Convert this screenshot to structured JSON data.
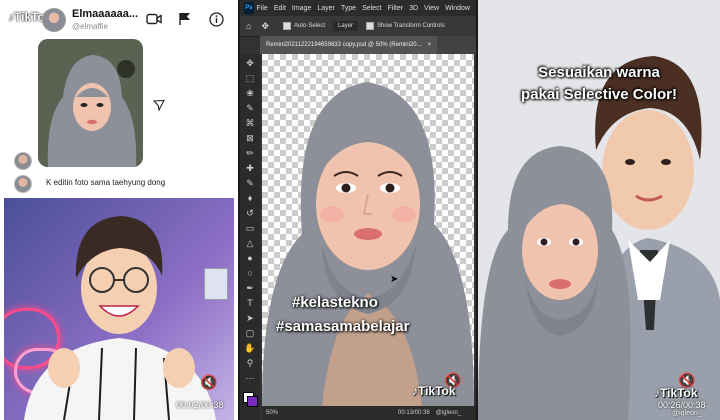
{
  "panel1": {
    "logo": "TikTok",
    "username": "Elmaaaaaa...",
    "handle": "@elmaffie",
    "chat_message": "K editin foto sama taehyung dong",
    "time": "00:02/00:38",
    "icons": [
      "tiktok-logo-icon",
      "video-camera-icon",
      "flag-icon",
      "info-icon",
      "share-icon",
      "mute-icon"
    ]
  },
  "panel2": {
    "menu": [
      "File",
      "Edit",
      "Image",
      "Layer",
      "Type",
      "Select",
      "Filter",
      "3D",
      "View",
      "Window"
    ],
    "options": {
      "auto_select": "Auto-Select",
      "layer_select": "Layer",
      "transform": "Show Transform Controls"
    },
    "doc_tab": "Remini20211222194659833 copy.psd @ 50% (Remini20...",
    "close_tab": "×",
    "hashtags": [
      "#kelastekno",
      "#samasamabelajar"
    ],
    "status": "50%",
    "tiktok": "TikTok",
    "handle": "@igleon_",
    "time": "00:13/00:38"
  },
  "panel3": {
    "caption_line1": "Sesuaikan warna",
    "caption_line2": "pakai Selective Color!",
    "tiktok": "TikTok",
    "handle": "@igleon_",
    "time": "00:26/00:38"
  },
  "colors": {
    "hijab": "#8d9099",
    "skin": "#f0c3ae",
    "lips": "#d96f6f",
    "ps_dark": "#2b2b2b",
    "ps_blue": "#31a8ff",
    "neon_pink": "#ff4b8b",
    "purple_bg": "#8d6fc6",
    "tiktok_red": "#fe2c55",
    "tiktok_cyan": "#25f4ee"
  }
}
